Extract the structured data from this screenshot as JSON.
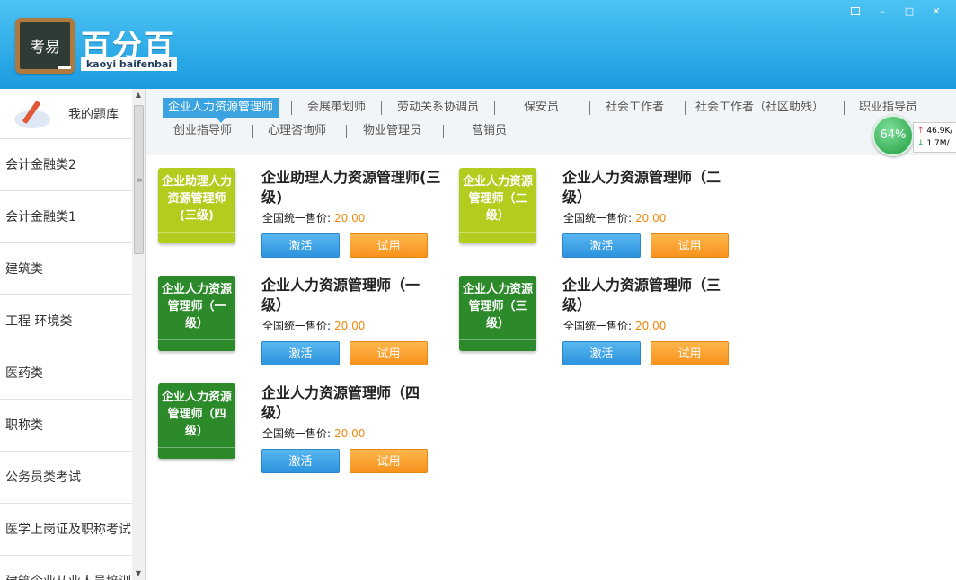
{
  "header": {
    "logo_badge": "考易",
    "logo_title": "百分百",
    "logo_subtitle": "kaoyi baifenbai",
    "win_minimize": "–",
    "win_maximize": "□",
    "win_close": "✕"
  },
  "sidebar": {
    "head_label": "我的题库",
    "items": [
      "会计金融类2",
      "会计金融类1",
      "建筑类",
      "工程 环境类",
      "医药类",
      "职称类",
      "公务员类考试",
      "医学上岗证及职称考试",
      "建筑企业从业人员培训"
    ]
  },
  "tabs": {
    "row1": [
      "企业人力资源管理师",
      "会展策划师",
      "劳动关系协调员",
      "保安员",
      "社会工作者",
      "社会工作者（社区助残）",
      "职业指导员"
    ],
    "row2": [
      "创业指导师",
      "心理咨询师",
      "物业管理员",
      "营销员"
    ],
    "active_index": 0
  },
  "net_monitor": {
    "percent": "64%",
    "up_speed": "46.9K/",
    "down_speed": "1.7M/"
  },
  "courses": [
    {
      "cover": "企业助理人力资源管理师(三级)",
      "title": "企业助理人力资源管理师(三级)",
      "price_label": "全国统一售价:",
      "price": "20.00",
      "activate": "激活",
      "trial": "试用",
      "cover_color": "#b3cc1e"
    },
    {
      "cover": "企业人力资源管理师（二级）",
      "title": "企业人力资源管理师（二级）",
      "price_label": "全国统一售价:",
      "price": "20.00",
      "activate": "激活",
      "trial": "试用",
      "cover_color": "#b3cc1e"
    },
    {
      "cover": "企业人力资源管理师（一级）",
      "title": "企业人力资源管理师（一级）",
      "price_label": "全国统一售价:",
      "price": "20.00",
      "activate": "激活",
      "trial": "试用",
      "cover_color": "#2d8a2b"
    },
    {
      "cover": "企业人力资源管理师（三级）",
      "title": "企业人力资源管理师（三级）",
      "price_label": "全国统一售价:",
      "price": "20.00",
      "activate": "激活",
      "trial": "试用",
      "cover_color": "#2d8a2b"
    },
    {
      "cover": "企业人力资源管理师（四级）",
      "title": "企业人力资源管理师（四级）",
      "price_label": "全国统一售价:",
      "price": "20.00",
      "activate": "激活",
      "trial": "试用",
      "cover_color": "#2d8a2b"
    }
  ]
}
